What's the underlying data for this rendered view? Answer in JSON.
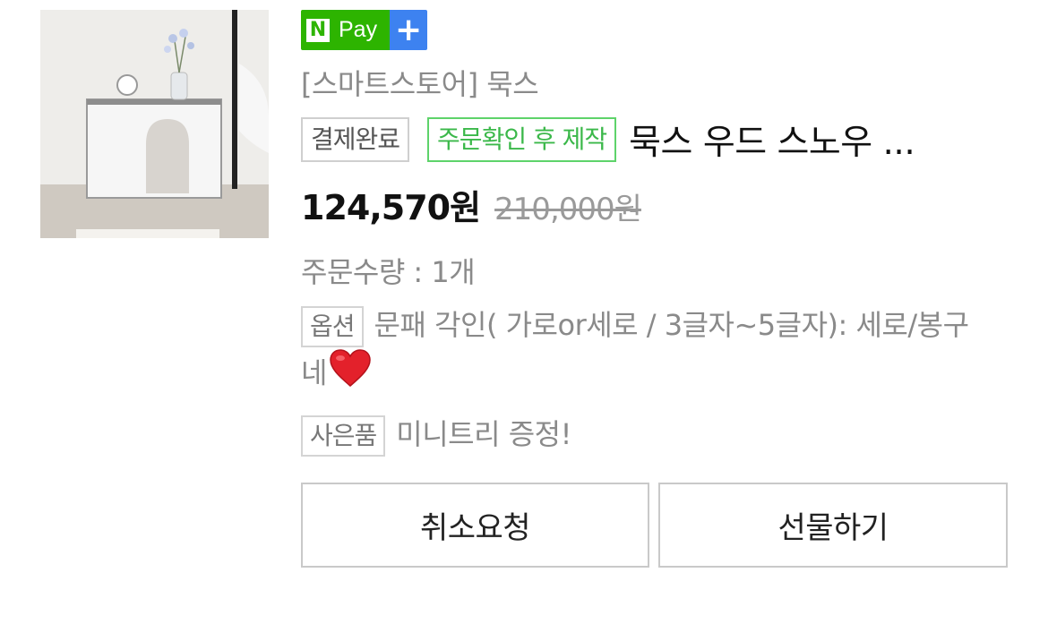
{
  "npay": {
    "n_letter": "N",
    "pay_label": "Pay",
    "plus_symbol": "+"
  },
  "store_name": "[스마트스토어] 묵스",
  "status_tags": {
    "payment": "결제완료",
    "production": "주문확인 후 제작"
  },
  "product_name": "묵스 우드 스노우 ...",
  "price": {
    "sale": "124,570원",
    "original": "210,000원"
  },
  "quantity_text": "주문수량 : 1개",
  "option": {
    "tag": "옵션",
    "text": "문패 각인( 가로or세로 / 3글자~5글자): 세로/봉구네"
  },
  "gift": {
    "tag": "사은품",
    "text": "미니트리 증정!"
  },
  "buttons": {
    "cancel": "취소요청",
    "gift": "선물하기"
  },
  "icons": {
    "heart": "red-heart-emoji"
  },
  "colors": {
    "npay_green": "#2db400",
    "npay_blue": "#3d82f0",
    "tag_green": "#3bb84a"
  }
}
